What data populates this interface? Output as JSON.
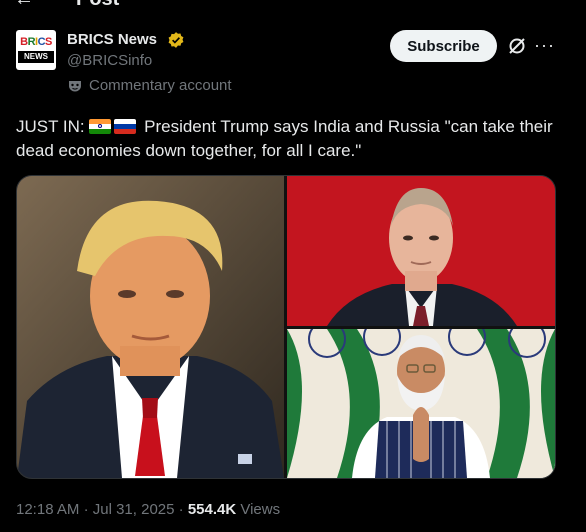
{
  "header": {
    "title": "Post"
  },
  "author": {
    "avatar_text_top": "BRICS",
    "avatar_text_bottom": "NEWS",
    "display_name": "BRICS News",
    "handle": "@BRICSinfo",
    "account_note": "Commentary account"
  },
  "actions": {
    "subscribe_label": "Subscribe"
  },
  "post": {
    "text_prefix": "JUST IN:",
    "text_body": "President Trump says India and Russia \"can take their dead economies down together, for all I care.\"",
    "flags": [
      "India flag",
      "Russia flag"
    ]
  },
  "meta": {
    "time": "12:18 AM",
    "date": "Jul 31, 2025",
    "views_count": "554.4K",
    "views_label": "Views"
  },
  "colors": {
    "background": "#000000",
    "text": "#e7e9ea",
    "muted": "#71767b",
    "verified": "#e2b719"
  },
  "icons": [
    "back-arrow-icon",
    "verified-badge-icon",
    "commentary-mask-icon",
    "grok-icon",
    "more-icon"
  ]
}
